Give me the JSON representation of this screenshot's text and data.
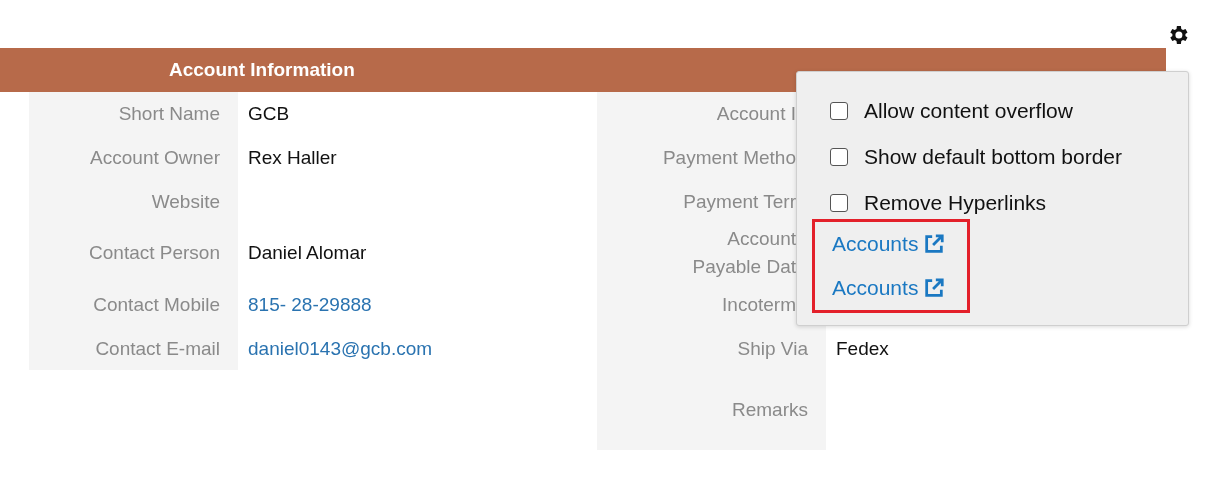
{
  "header": {
    "title": "Account Information"
  },
  "left_fields": [
    {
      "label": "Short Name",
      "value": "GCB",
      "link": false
    },
    {
      "label": "Account Owner",
      "value": "Rex Haller",
      "link": false
    },
    {
      "label": "Website"
    },
    {
      "label": "Contact Person",
      "value": "Daniel Alomar",
      "link": false
    },
    {
      "label": "Contact Mobile",
      "value": "815- 28-29888",
      "link": true
    },
    {
      "label": "Contact E-mail",
      "value": "daniel0143@gcb.com",
      "link": true
    }
  ],
  "right_fields": [
    {
      "label": "Account I",
      "covered": true
    },
    {
      "label": "Payment Metho",
      "covered": true
    },
    {
      "label": "Payment Terr",
      "covered": true
    },
    {
      "label": "Account\nPayable  Dat",
      "covered": true
    },
    {
      "label": "Incoterm",
      "covered": true
    },
    {
      "label": "Ship Via",
      "value": "Fedex"
    },
    {
      "label": "Remarks"
    }
  ],
  "settings_menu": {
    "options": [
      {
        "label": "Allow content overflow",
        "checked": false
      },
      {
        "label": "Show default bottom border",
        "checked": false
      },
      {
        "label": "Remove Hyperlinks",
        "checked": false
      }
    ],
    "links": [
      "Accounts",
      "Accounts"
    ]
  }
}
